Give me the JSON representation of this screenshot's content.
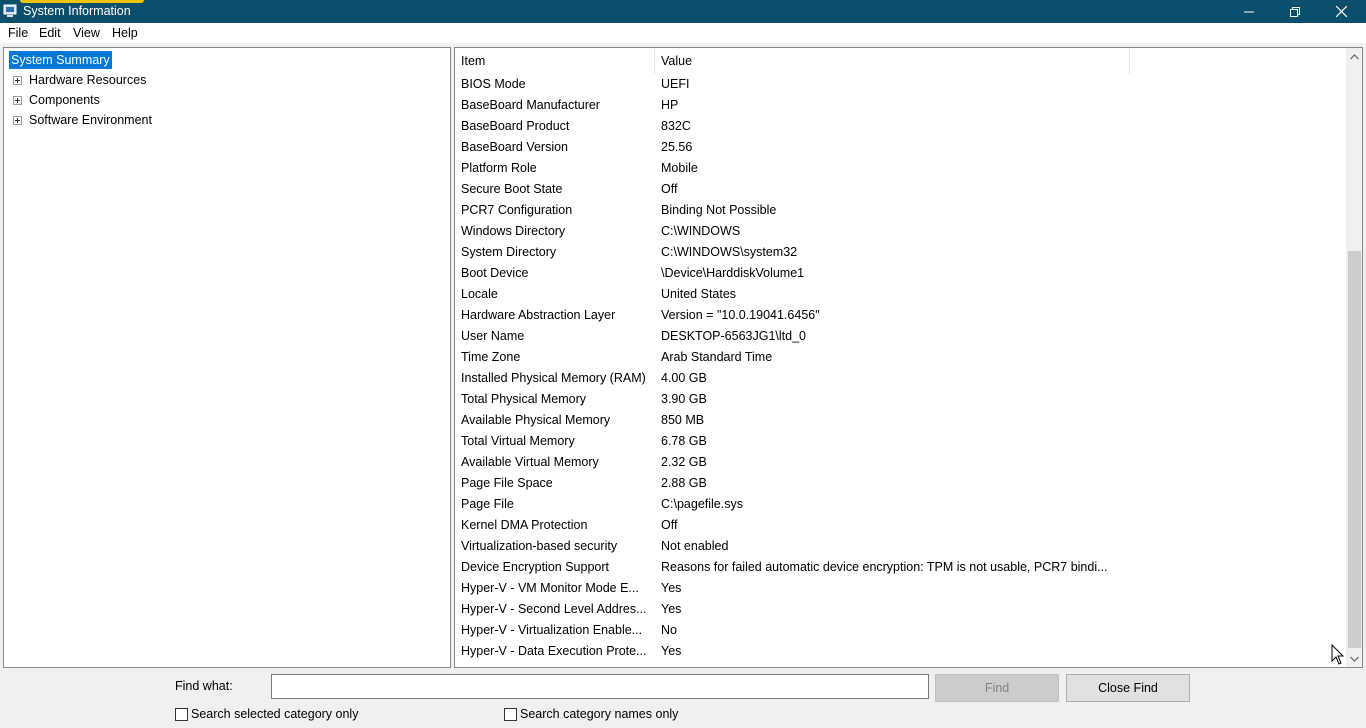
{
  "window": {
    "title": "System Information",
    "controls": {
      "minimize": "minimize-icon",
      "restore": "restore-icon",
      "close": "close-icon"
    }
  },
  "menu": [
    "File",
    "Edit",
    "View",
    "Help"
  ],
  "tree": {
    "selected": "System Summary",
    "children": [
      "Hardware Resources",
      "Components",
      "Software Environment"
    ]
  },
  "list": {
    "headers": {
      "item": "Item",
      "value": "Value"
    },
    "rows": [
      {
        "item": "BIOS Mode",
        "value": "UEFI"
      },
      {
        "item": "BaseBoard Manufacturer",
        "value": "HP"
      },
      {
        "item": "BaseBoard Product",
        "value": "832C"
      },
      {
        "item": "BaseBoard Version",
        "value": "25.56"
      },
      {
        "item": "Platform Role",
        "value": "Mobile"
      },
      {
        "item": "Secure Boot State",
        "value": "Off"
      },
      {
        "item": "PCR7 Configuration",
        "value": "Binding Not Possible"
      },
      {
        "item": "Windows Directory",
        "value": "C:\\WINDOWS"
      },
      {
        "item": "System Directory",
        "value": "C:\\WINDOWS\\system32"
      },
      {
        "item": "Boot Device",
        "value": "\\Device\\HarddiskVolume1"
      },
      {
        "item": "Locale",
        "value": "United States"
      },
      {
        "item": "Hardware Abstraction Layer",
        "value": "Version = \"10.0.19041.6456\""
      },
      {
        "item": "User Name",
        "value": "DESKTOP-6563JG1\\ltd_0"
      },
      {
        "item": "Time Zone",
        "value": "Arab Standard Time"
      },
      {
        "item": "Installed Physical Memory (RAM)",
        "value": "4.00 GB"
      },
      {
        "item": "Total Physical Memory",
        "value": "3.90 GB"
      },
      {
        "item": "Available Physical Memory",
        "value": "850 MB"
      },
      {
        "item": "Total Virtual Memory",
        "value": "6.78 GB"
      },
      {
        "item": "Available Virtual Memory",
        "value": "2.32 GB"
      },
      {
        "item": "Page File Space",
        "value": "2.88 GB"
      },
      {
        "item": "Page File",
        "value": "C:\\pagefile.sys"
      },
      {
        "item": "Kernel DMA Protection",
        "value": "Off"
      },
      {
        "item": "Virtualization-based security",
        "value": "Not enabled"
      },
      {
        "item": "Device Encryption Support",
        "value": "Reasons for failed automatic device encryption: TPM is not usable, PCR7 bindi..."
      },
      {
        "item": "Hyper-V - VM Monitor Mode E...",
        "value": "Yes"
      },
      {
        "item": "Hyper-V - Second Level Addres...",
        "value": "Yes"
      },
      {
        "item": "Hyper-V - Virtualization Enable...",
        "value": "No"
      },
      {
        "item": "Hyper-V - Data Execution Prote...",
        "value": "Yes"
      }
    ]
  },
  "find": {
    "label": "Find what:",
    "value": "",
    "find_button": "Find",
    "close_button": "Close Find",
    "checkbox_selected": "Search selected category only",
    "checkbox_names": "Search category names only"
  },
  "colors": {
    "titlebar": "#0b4f6c",
    "selection": "#0078d7",
    "title_accent": "#f5c400"
  }
}
